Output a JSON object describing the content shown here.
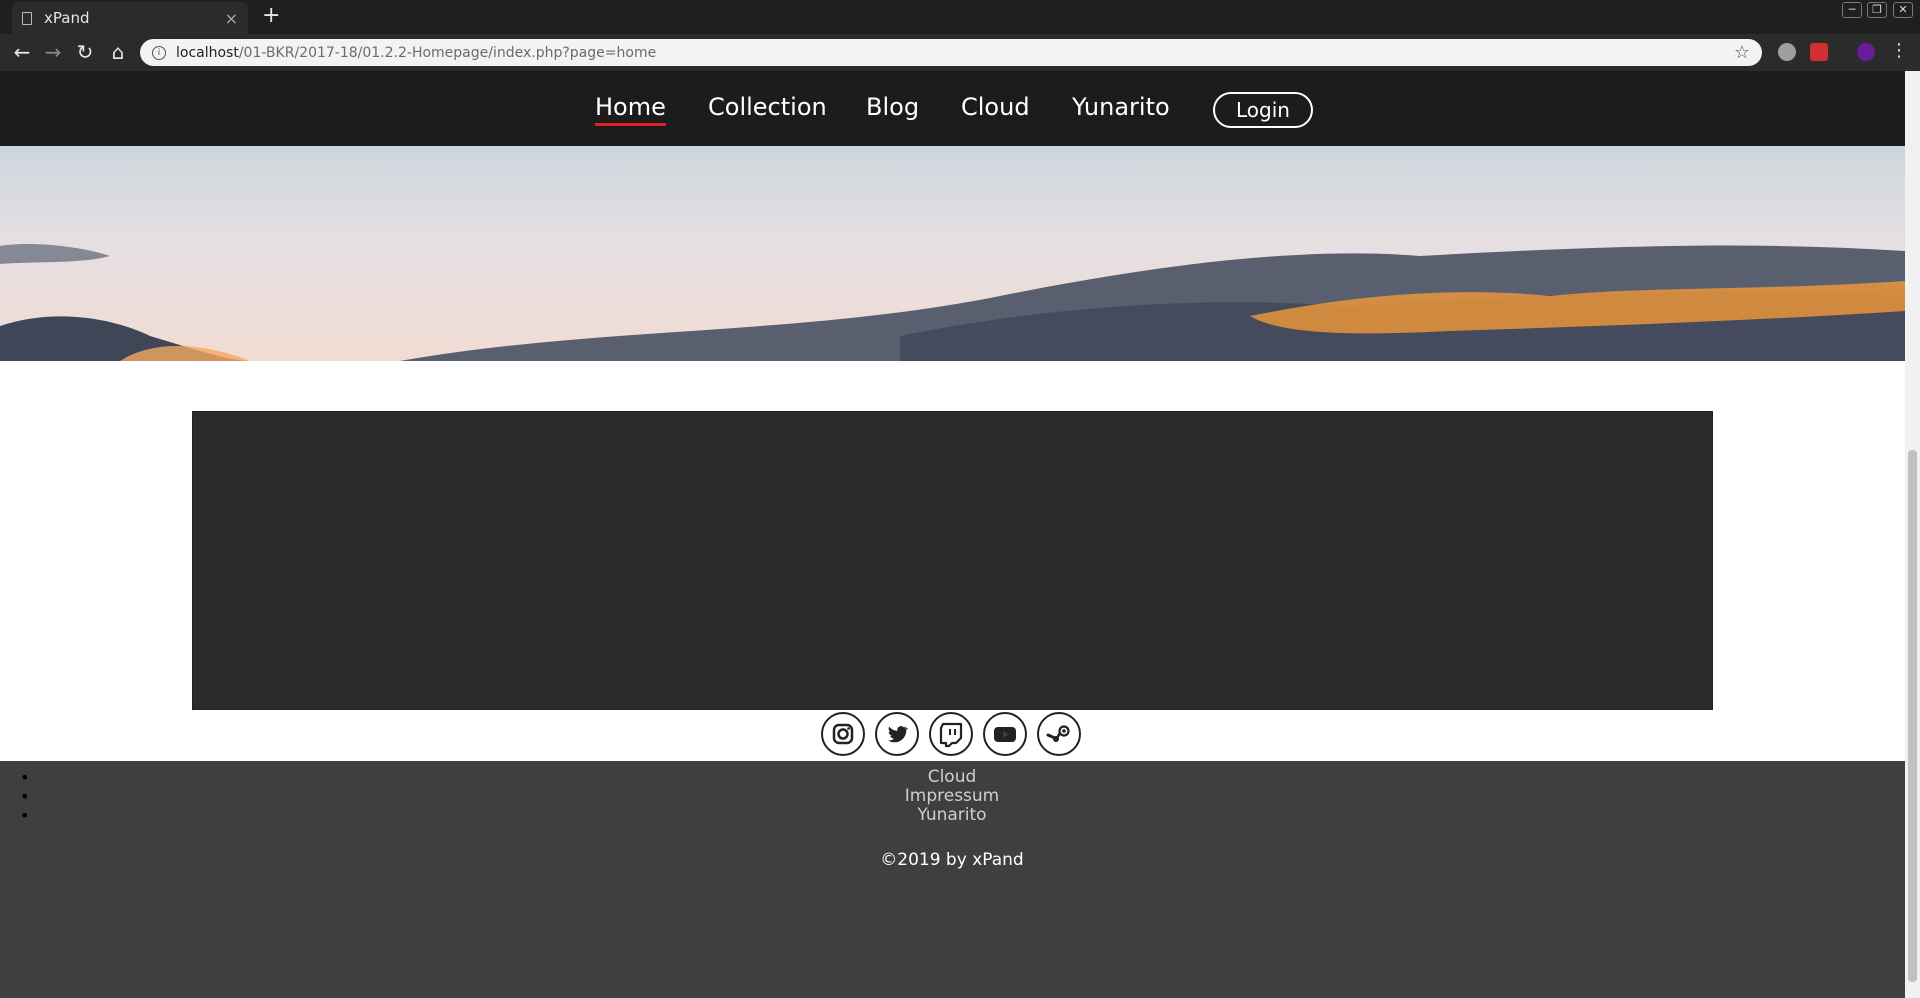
{
  "browser": {
    "tab_title": "xPand",
    "tab_close": "×",
    "new_tab": "+",
    "url_host": "localhost",
    "url_path": "/01-BKR/2017-18/01.2.2-Homepage/index.php?page=home",
    "window_controls": [
      "─",
      "❐",
      "✕"
    ]
  },
  "nav": {
    "items": [
      "Home",
      "Collection",
      "Blog",
      "Cloud",
      "Yunarito"
    ],
    "active": "Home",
    "login_label": "Login"
  },
  "footer": {
    "social_icons": [
      "instagram-icon",
      "twitter-icon",
      "twitch-icon",
      "youtube-icon",
      "steam-icon"
    ],
    "bullets": [
      "•",
      "•",
      "•"
    ],
    "links": [
      "Cloud",
      "Impressum",
      "Yunarito"
    ],
    "copyright": "©2019 by xPand"
  },
  "colors": {
    "nav_bg": "#1c1c1c",
    "active_underline": "#e02020",
    "content_box": "#2b2b2b",
    "footer_bg": "#3f3f3f"
  }
}
